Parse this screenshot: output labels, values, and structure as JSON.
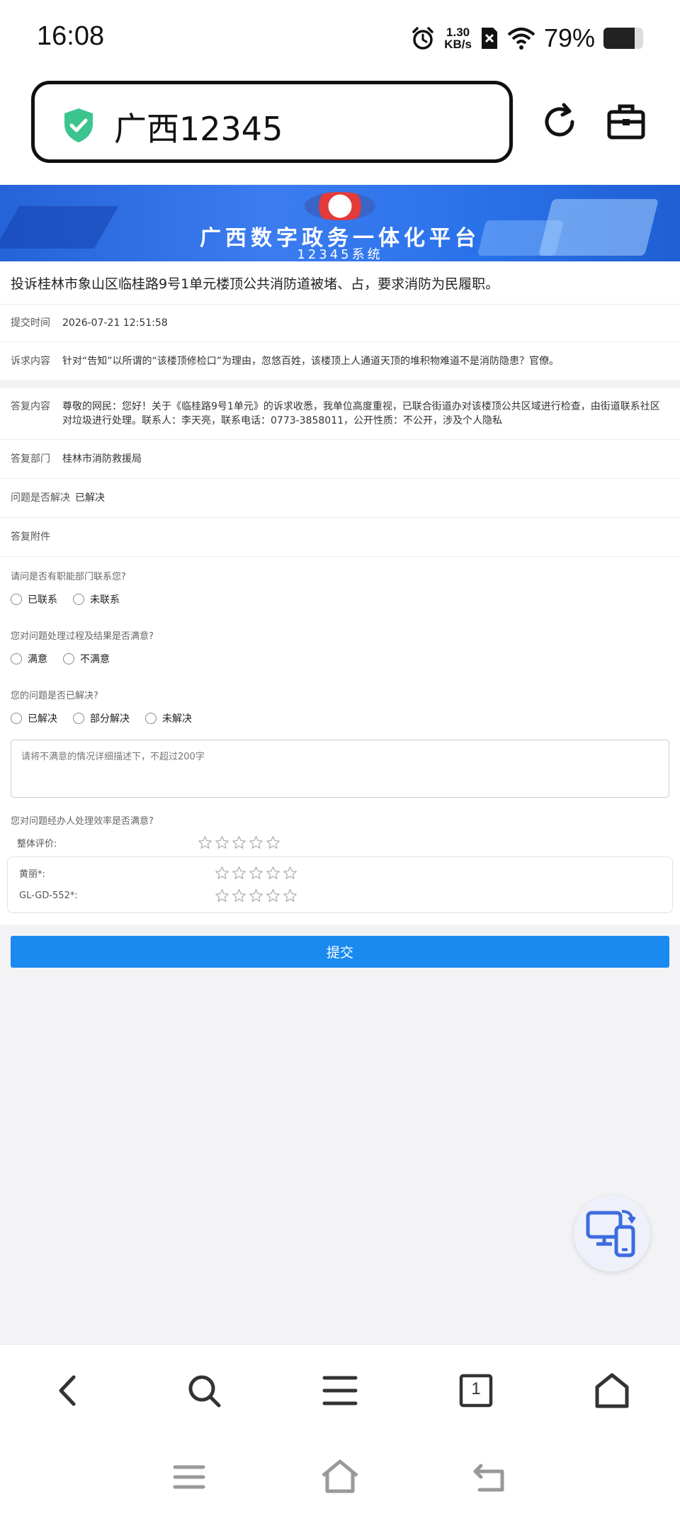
{
  "status_bar": {
    "time": "16:08",
    "net_speed_value": "1.30",
    "net_speed_unit": "KB/s",
    "battery_percent": "79%",
    "battery_level": 0.79,
    "icons": [
      "alarm-icon",
      "sim-off-icon",
      "wifi-icon",
      "battery-icon"
    ]
  },
  "browser": {
    "url_text": "广西12345",
    "secure_color": "#3cc48f"
  },
  "banner": {
    "title": "广西数字政务一体化平台",
    "subtitle": "12345系统"
  },
  "complaint": {
    "title": "投诉桂林市象山区临桂路9号1单元楼顶公共消防道被堵、占，要求消防为民履职。",
    "submit_time_label": "提交时间",
    "submit_time": "2026-07-21 12:51:58",
    "content_label": "诉求内容",
    "content": "针对“告知”以所谓的“该楼顶修检口”为理由，忽悠百姓，该楼顶上人通道天顶的堆积物难道不是消防隐患？官僚。",
    "reply_label": "答复内容",
    "reply": "尊敬的网民：您好！关于《临桂路9号1单元》的诉求收悉，我单位高度重视，已联合街道办对该楼顶公共区域进行检查，由街道联系社区对垃圾进行处理。联系人：李天亮，联系电话：0773-3858011，公开性质：不公开，涉及个人隐私",
    "dept_label": "答复部门",
    "dept": "桂林市消防救援局",
    "resolved_label": "问题是否解决",
    "resolved": "已解决",
    "attachment_label": "答复附件"
  },
  "survey": {
    "q1": "请问是否有职能部门联系您?",
    "q1_options": [
      "已联系",
      "未联系"
    ],
    "q2": "您对问题处理过程及结果是否满意?",
    "q2_options": [
      "满意",
      "不满意"
    ],
    "q3": "您的问题是否已解决?",
    "q3_options": [
      "已解决",
      "部分解决",
      "未解决"
    ],
    "textarea_placeholder": "请将不满意的情况详细描述下，不超过200字",
    "q4": "您对问题经办人处理效率是否满意?",
    "overall_label": "整体评价:",
    "handler1_label": "黄丽*:",
    "handler2_label": "GL-GD-552*:",
    "max_stars": 5,
    "overall_rating": 0,
    "handler1_rating": 0,
    "handler2_rating": 0,
    "submit_label": "提交",
    "accent_color": "#1b8af0"
  },
  "floating": {
    "icon": "device-switch-icon"
  },
  "bottom_nav": {
    "tab_count": "1"
  }
}
